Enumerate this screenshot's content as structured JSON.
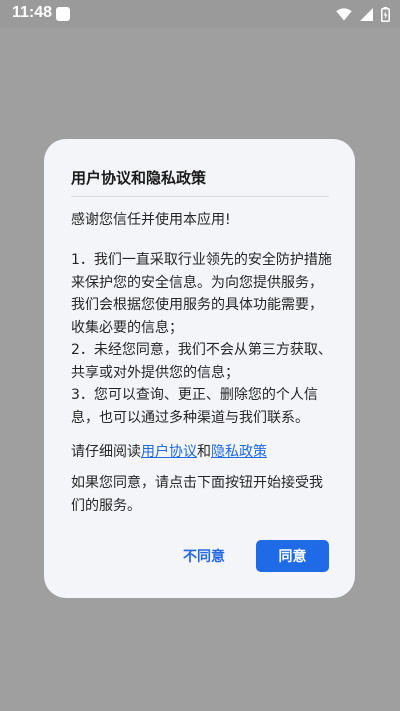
{
  "status_bar": {
    "time": "11:48",
    "icons": [
      "notification-icon",
      "wifi-icon",
      "signal-icon",
      "battery-icon"
    ]
  },
  "dialog": {
    "title": "用户协议和隐私政策",
    "greeting": "感谢您信任并使用本应用!",
    "points": [
      "1．我们一直采取行业领先的安全防护措施来保护您的安全信息。为向您提供服务，我们会根据您使用服务的具体功能需要，收集必要的信息；",
      "2．未经您同意，我们不会从第三方获取、共享或对外提供您的信息；",
      "3．您可以查询、更正、删除您的个人信息，也可以通过多种渠道与我们联系。"
    ],
    "read_prefix": "请仔细阅读",
    "user_agreement_link": "用户协议",
    "read_joiner": "和",
    "privacy_policy_link": "隐私政策",
    "agree_prompt": "如果您同意，请点击下面按钮开始接受我们的服务。",
    "disagree_button": "不同意",
    "agree_button": "同意"
  },
  "colors": {
    "accent": "#1f6ae6",
    "overlay": "#9f9f9f",
    "dialog_bg": "#f4f5f9"
  }
}
